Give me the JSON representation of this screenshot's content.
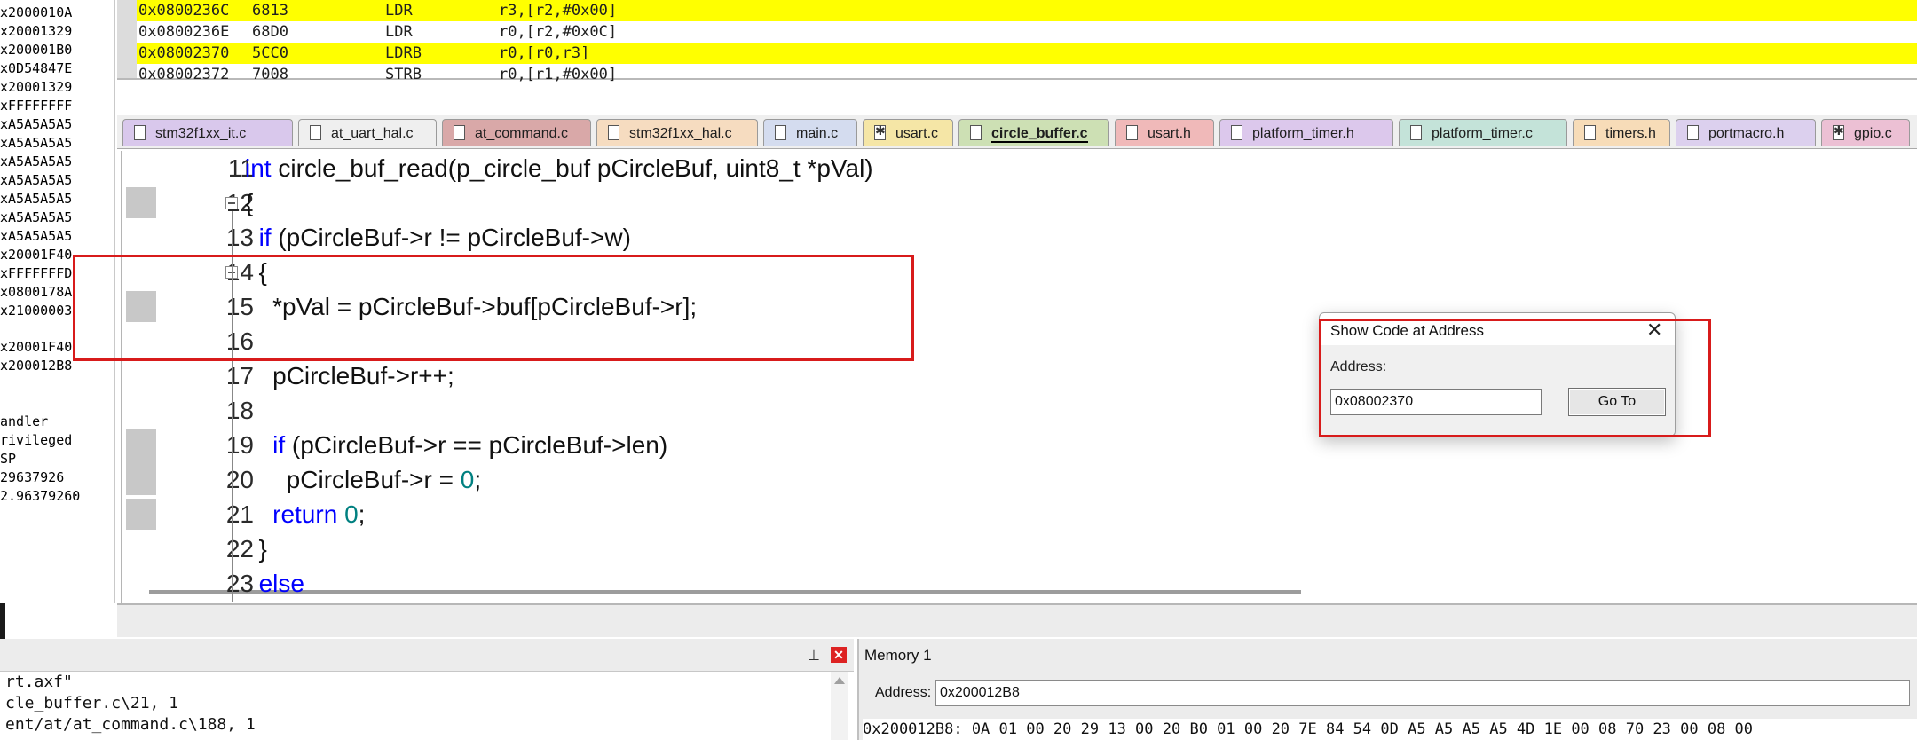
{
  "registers": [
    "x2000010A",
    "x20001329",
    "x200001B0",
    "x0D54847E",
    "x20001329",
    "xFFFFFFFF",
    "xA5A5A5A5",
    "xA5A5A5A5",
    "xA5A5A5A5",
    "xA5A5A5A5",
    "xA5A5A5A5",
    "xA5A5A5A5",
    "xA5A5A5A5",
    "x20001F40",
    "xFFFFFFFD",
    "x0800178A",
    "x21000003",
    "",
    "x20001F40",
    "x200012B8",
    "",
    "",
    "",
    "andler",
    "rivileged",
    "SP",
    "29637926",
    "2.96379260"
  ],
  "disassembly": [
    {
      "addr": "0x0800236C",
      "code": "6813",
      "mnemonic": "LDR",
      "operands": "r3,[r2,#0x00]",
      "highlight": true
    },
    {
      "addr": "0x0800236E",
      "code": "68D0",
      "mnemonic": "LDR",
      "operands": "r0,[r2,#0x0C]",
      "highlight": false
    },
    {
      "addr": "0x08002370",
      "code": "5CC0",
      "mnemonic": "LDRB",
      "operands": "r0,[r0,r3]",
      "highlight": true
    },
    {
      "addr": "0x08002372",
      "code": "7008",
      "mnemonic": "STRB",
      "operands": "r0,[r1,#0x00]",
      "highlight": false
    }
  ],
  "tabs": [
    {
      "label": "stm32f1xx_it.c",
      "color": "#d9c8ec",
      "gear": false,
      "active": false
    },
    {
      "label": "at_uart_hal.c",
      "color": "#efefef",
      "gear": false,
      "active": false
    },
    {
      "label": "at_command.c",
      "color": "#d9a8a8",
      "gear": false,
      "active": false
    },
    {
      "label": "stm32f1xx_hal.c",
      "color": "#f6dcc0",
      "gear": false,
      "active": false
    },
    {
      "label": "main.c",
      "color": "#d4dcef",
      "gear": false,
      "active": false
    },
    {
      "label": "usart.c",
      "color": "#f5e6a6",
      "gear": true,
      "active": false
    },
    {
      "label": "circle_buffer.c",
      "color": "#cde0b4",
      "gear": false,
      "active": true
    },
    {
      "label": "usart.h",
      "color": "#f0b9b9",
      "gear": false,
      "active": false
    },
    {
      "label": "platform_timer.h",
      "color": "#dcc8ec",
      "gear": false,
      "active": false
    },
    {
      "label": "platform_timer.c",
      "color": "#c4e3d9",
      "gear": false,
      "active": false
    },
    {
      "label": "timers.h",
      "color": "#f7dcb8",
      "gear": false,
      "active": false
    },
    {
      "label": "portmacro.h",
      "color": "#dcd0ee",
      "gear": false,
      "active": false
    },
    {
      "label": "gpio.c",
      "color": "#ecc0d4",
      "gear": true,
      "active": false
    }
  ],
  "code_lines": [
    {
      "num": "11",
      "text": "int circle_buf_read(p_circle_buf pCircleBuf, uint8_t *pVal)"
    },
    {
      "num": "12",
      "text": "{"
    },
    {
      "num": "13",
      "text": "  if (pCircleBuf->r != pCircleBuf->w)"
    },
    {
      "num": "14",
      "text": "  {"
    },
    {
      "num": "15",
      "text": "    *pVal = pCircleBuf->buf[pCircleBuf->r];"
    },
    {
      "num": "16",
      "text": ""
    },
    {
      "num": "17",
      "text": "    pCircleBuf->r++;"
    },
    {
      "num": "18",
      "text": ""
    },
    {
      "num": "19",
      "text": "    if (pCircleBuf->r == pCircleBuf->len)"
    },
    {
      "num": "20",
      "text": "      pCircleBuf->r = 0;"
    },
    {
      "num": "21",
      "text": "    return 0;"
    },
    {
      "num": "22",
      "text": "  }"
    },
    {
      "num": "23",
      "text": "  else"
    }
  ],
  "dialog": {
    "title": "Show Code at Address",
    "close": "✕",
    "address_label": "Address:",
    "address_value": "0x08002370",
    "button": "Go To"
  },
  "build_output": {
    "pin": "⊥",
    "close": "✕",
    "lines": [
      "rt.axf\"",
      "cle_buffer.c\\21, 1",
      "ent/at/at_command.c\\188, 1"
    ]
  },
  "memory": {
    "title": "Memory 1",
    "address_label": "Address:",
    "address_value": "0x200012B8",
    "row": "0x200012B8: 0A 01 00 20 29 13 00 20 B0 01 00 20 7E 84 54 0D A5 A5 A5 A5 4D 1E 00 08 70 23 00 08 00"
  },
  "colors": {
    "highlight": "#ffff00",
    "keyword": "#0000ff",
    "number": "#008080",
    "annotation": "#d81b1b"
  }
}
